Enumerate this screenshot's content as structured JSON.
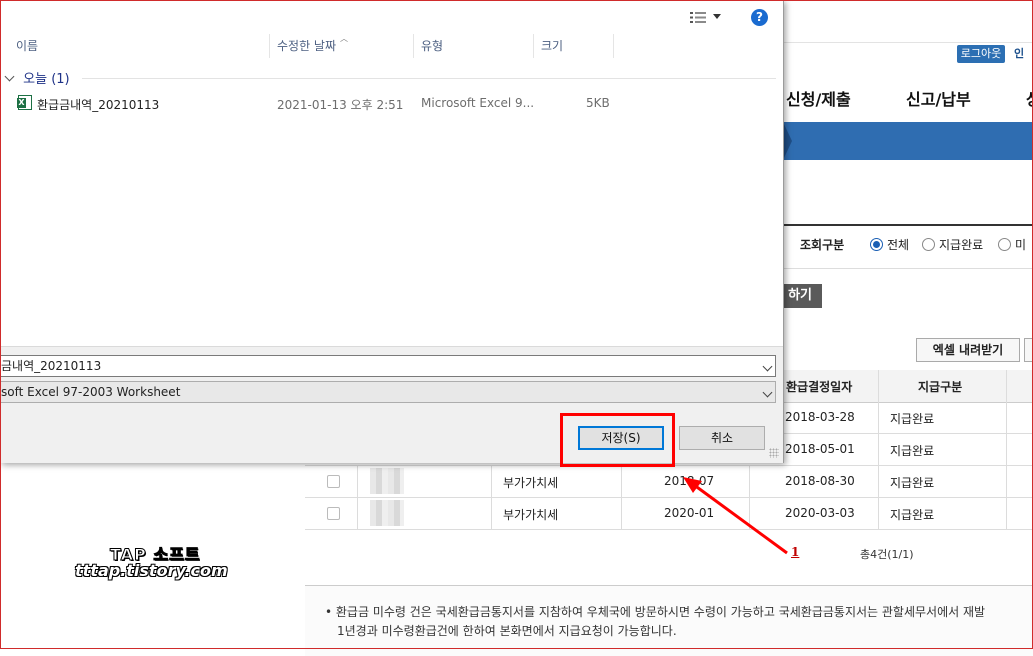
{
  "background_page": {
    "top": {
      "logout_label": "로그아웃",
      "cut_text": "인"
    },
    "nav": [
      "신청/제출",
      "신고/납부",
      "상"
    ],
    "filter": {
      "label": "조회구분",
      "options": [
        {
          "label": "전체",
          "selected": true
        },
        {
          "label": "지급완료",
          "selected": false
        },
        {
          "label": "미"
        }
      ]
    },
    "search_button_label": "하기",
    "excel_button_label": "엑셀 내려받기",
    "table": {
      "headers": [
        "환급결정일자",
        "지급구분"
      ],
      "rows": [
        {
          "tax_type": "",
          "period": "",
          "decision_date": "2018-03-28",
          "status": "지급완료"
        },
        {
          "tax_type": "",
          "period": "",
          "decision_date": "2018-05-01",
          "status": "지급완료"
        },
        {
          "tax_type": "부가가치세",
          "period": "2018-07",
          "decision_date": "2018-08-30",
          "status": "지급완료"
        },
        {
          "tax_type": "부가가치세",
          "period": "2020-01",
          "decision_date": "2020-03-03",
          "status": "지급완료"
        }
      ],
      "total": "총4건(1/1)"
    },
    "notice": [
      "• 환급금 미수령 건은 국세환급금통지서를 지참하여 우체국에 방문하시면 수령이 가능하고 국세환급금통지서는 관할세무서에서 재발",
      "1년경과 미수령환급건에 한하여 본화면에서 지급요청이 가능합니다."
    ]
  },
  "watermark": {
    "line1": "TAP 소프트",
    "line2": "tttap.tistory.com"
  },
  "annotation": {
    "number": "1",
    "color": "#ff0000"
  },
  "dialog": {
    "toolbar": {
      "view_icon": "view-options-icon",
      "help_label": "?"
    },
    "columns": [
      "이름",
      "수정한 날짜",
      "유형",
      "크기"
    ],
    "group": {
      "label": "오늘 (1)"
    },
    "files": [
      {
        "name": "환급금내역_20210113",
        "modified": "2021-01-13 오후 2:51",
        "type": "Microsoft Excel 9...",
        "size": "5KB",
        "icon": "excel-file-icon"
      }
    ],
    "filename_value": "금내역_20210113",
    "filetype_value": "soft Excel 97-2003 Worksheet",
    "save_label": "저장(S)",
    "cancel_label": "취소"
  }
}
